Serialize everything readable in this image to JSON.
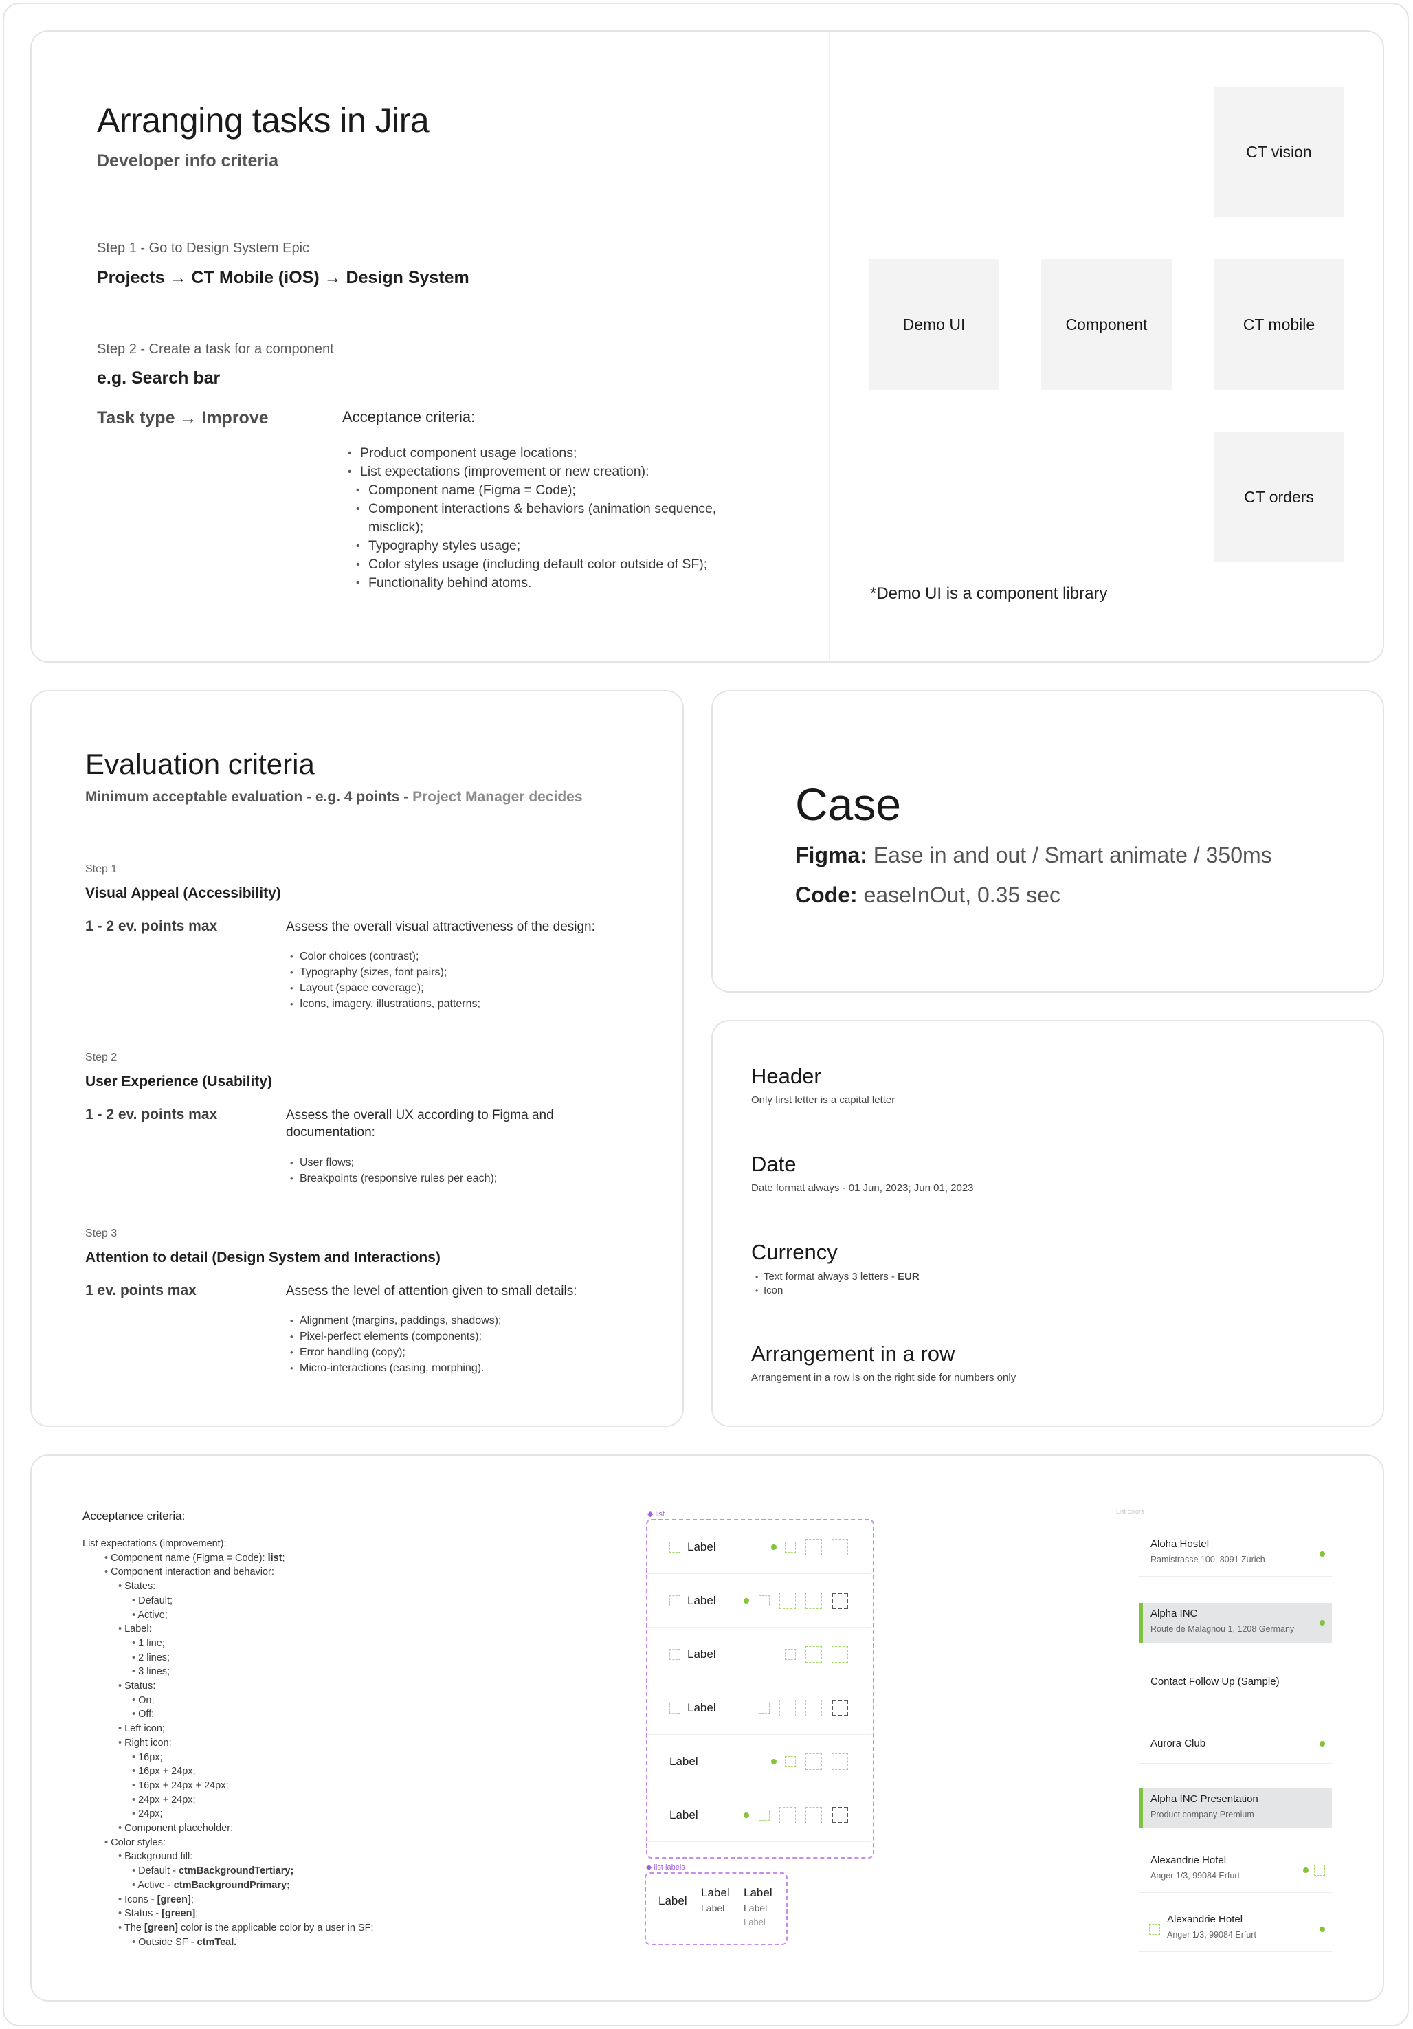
{
  "jira": {
    "title": "Arranging tasks in Jira",
    "subtitle": "Developer info criteria",
    "step1_label": "Step 1 - Go to Design System Epic",
    "step1_path": "Projects → CT Mobile (iOS) → Design System",
    "step2_label": "Step 2 - Create a task for a component",
    "step2_example": "e.g. Search bar",
    "task_type": "Task type → Improve",
    "acceptance_title": "Acceptance criteria:",
    "acceptance_items": [
      "Product component usage locations;",
      "List expectations (improvement or new creation):"
    ],
    "acceptance_subitems": [
      "Component name (Figma = Code);",
      "Component interactions & behaviors (animation sequence,",
      "misclick);",
      "Typography styles usage;",
      "Color styles usage (including default color outside of SF);",
      "Functionality behind atoms."
    ],
    "tiles": {
      "ct_vision": "CT vision",
      "demo_ui": "Demo UI",
      "component": "Component",
      "ct_mobile": "CT mobile",
      "ct_orders": "CT orders"
    },
    "note": "*Demo UI is a component library"
  },
  "evaluation": {
    "title": "Evaluation criteria",
    "subtitle_bold": "Minimum acceptable evaluation - e.g. 4 points - ",
    "subtitle_light": "Project Manager decides",
    "steps": [
      {
        "step": "Step 1",
        "heading": "Visual Appeal (Accessibility)",
        "points": "1 - 2 ev. points max",
        "desc": "Assess the overall visual attractiveness of the design:",
        "items": [
          "Color choices (contrast);",
          "Typography (sizes, font pairs);",
          "Layout (space coverage);",
          "Icons, imagery, illustrations, patterns;"
        ]
      },
      {
        "step": "Step 2",
        "heading": "User Experience (Usability)",
        "points": "1 - 2 ev. points max",
        "desc": "Assess the overall UX according to Figma and documentation:",
        "items": [
          "User flows;",
          "Breakpoints (responsive rules per each);"
        ]
      },
      {
        "step": "Step 3",
        "heading": "Attention to detail (Design System and Interactions)",
        "points": "1 ev. points max",
        "desc": "Assess the level of attention given to small details:",
        "items": [
          "Alignment (margins, paddings, shadows);",
          "Pixel-perfect elements (components);",
          "Error handling (copy);",
          "Micro-interactions (easing, morphing)."
        ]
      }
    ]
  },
  "case": {
    "title": "Case",
    "figma_label": "Figma:",
    "figma_value": "Ease in and out / Smart animate / 350ms",
    "code_label": "Code:",
    "code_value": "easeInOut, 0.35 sec"
  },
  "rules": {
    "header_title": "Header",
    "header_desc": "Only first letter is a capital letter",
    "date_title": "Date",
    "date_desc": "Date format always - 01 Jun, 2023; Jun 01, 2023",
    "currency_title": "Currency",
    "currency_item1_prefix": "Text format always 3 letters - ",
    "currency_item1_bold": "EUR",
    "currency_item2": "Icon",
    "row_title": "Arrangement in a row",
    "row_desc": "Arrangement in a row is on the right side for numbers only"
  },
  "list_spec": {
    "title": "Acceptance criteria:",
    "intro": "List expectations (improvement):",
    "lines": {
      "l1a": "Component name (Figma = Code): ",
      "l1b": "list",
      "l1c": ";",
      "l2": "Component interaction and behavior:",
      "l3": "States:",
      "l4": "Default;",
      "l5": "Active;",
      "l6": "Label:",
      "l7": "1 line;",
      "l8": "2 lines;",
      "l9": "3 lines;",
      "l10": "Status:",
      "l11": "On;",
      "l12": "Off;",
      "l13": "Left icon;",
      "l14": "Right icon:",
      "l15": "16px;",
      "l16": "16px + 24px;",
      "l17": "16px + 24px + 24px;",
      "l18": "24px + 24px;",
      "l19": "24px;",
      "l20": "Component placeholder;",
      "l21": "Color styles:",
      "l22": "Background fill:",
      "l23a": "Default - ",
      "l23b": "ctmBackgroundTertiary;",
      "l24a": "Active - ",
      "l24b": "ctmBackgroundPrimary;",
      "l25a": "Icons - ",
      "l25b": "[green]",
      "l25c": ";",
      "l26a": "Status - ",
      "l26b": "[green]",
      "l26c": ";",
      "l27a": "The ",
      "l27b": "[green]",
      "l27c": " color is the applicable color by a user in SF;",
      "l28a": "Outside SF - ",
      "l28b": "ctmTeal."
    },
    "list_tag": "◆ list",
    "row_label": "Label",
    "labels_tag": "◆ list labels",
    "labels_col1": "Label",
    "labels_col2_top": "Label",
    "labels_col2_bottom": "Label",
    "labels_col3_top": "Label",
    "labels_col3_mid": "Label",
    "labels_col3_bottom": "Label",
    "colors_tag": "List colors",
    "colors": {
      "green": "#84c33a",
      "purple": "#c48cf0"
    }
  },
  "demo_list": [
    {
      "title": "Aloha Hostel",
      "subtitle": "Ramistrasse 100, 8091 Zurich"
    },
    {
      "title": "Alpha INC",
      "subtitle": "Route de Malagnou 1, 1208 Germany"
    },
    {
      "title": "Contact Follow Up (Sample)",
      "subtitle": ""
    },
    {
      "title": "Aurora Club",
      "subtitle": ""
    },
    {
      "title": "Alpha INC Presentation",
      "subtitle": "Product company Premium"
    },
    {
      "title": "Alexandrie Hotel",
      "subtitle": "Anger 1/3, 99084 Erfurt"
    },
    {
      "title": "Alexandrie Hotel",
      "subtitle": "Anger 1/3, 99084 Erfurt"
    }
  ]
}
